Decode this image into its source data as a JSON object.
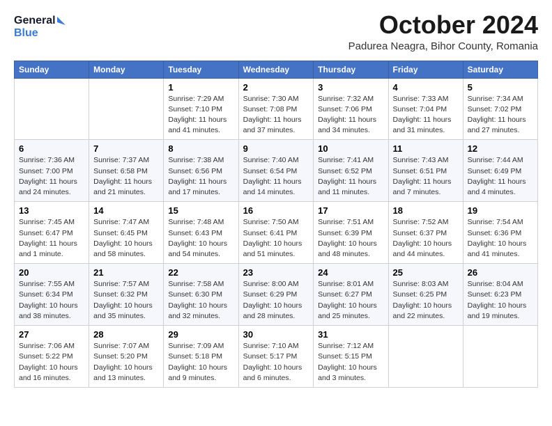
{
  "header": {
    "logo_line1": "General",
    "logo_line2": "Blue",
    "month": "October 2024",
    "location": "Padurea Neagra, Bihor County, Romania"
  },
  "weekdays": [
    "Sunday",
    "Monday",
    "Tuesday",
    "Wednesday",
    "Thursday",
    "Friday",
    "Saturday"
  ],
  "weeks": [
    [
      {
        "day": "",
        "info": ""
      },
      {
        "day": "",
        "info": ""
      },
      {
        "day": "1",
        "info": "Sunrise: 7:29 AM\nSunset: 7:10 PM\nDaylight: 11 hours and 41 minutes."
      },
      {
        "day": "2",
        "info": "Sunrise: 7:30 AM\nSunset: 7:08 PM\nDaylight: 11 hours and 37 minutes."
      },
      {
        "day": "3",
        "info": "Sunrise: 7:32 AM\nSunset: 7:06 PM\nDaylight: 11 hours and 34 minutes."
      },
      {
        "day": "4",
        "info": "Sunrise: 7:33 AM\nSunset: 7:04 PM\nDaylight: 11 hours and 31 minutes."
      },
      {
        "day": "5",
        "info": "Sunrise: 7:34 AM\nSunset: 7:02 PM\nDaylight: 11 hours and 27 minutes."
      }
    ],
    [
      {
        "day": "6",
        "info": "Sunrise: 7:36 AM\nSunset: 7:00 PM\nDaylight: 11 hours and 24 minutes."
      },
      {
        "day": "7",
        "info": "Sunrise: 7:37 AM\nSunset: 6:58 PM\nDaylight: 11 hours and 21 minutes."
      },
      {
        "day": "8",
        "info": "Sunrise: 7:38 AM\nSunset: 6:56 PM\nDaylight: 11 hours and 17 minutes."
      },
      {
        "day": "9",
        "info": "Sunrise: 7:40 AM\nSunset: 6:54 PM\nDaylight: 11 hours and 14 minutes."
      },
      {
        "day": "10",
        "info": "Sunrise: 7:41 AM\nSunset: 6:52 PM\nDaylight: 11 hours and 11 minutes."
      },
      {
        "day": "11",
        "info": "Sunrise: 7:43 AM\nSunset: 6:51 PM\nDaylight: 11 hours and 7 minutes."
      },
      {
        "day": "12",
        "info": "Sunrise: 7:44 AM\nSunset: 6:49 PM\nDaylight: 11 hours and 4 minutes."
      }
    ],
    [
      {
        "day": "13",
        "info": "Sunrise: 7:45 AM\nSunset: 6:47 PM\nDaylight: 11 hours and 1 minute."
      },
      {
        "day": "14",
        "info": "Sunrise: 7:47 AM\nSunset: 6:45 PM\nDaylight: 10 hours and 58 minutes."
      },
      {
        "day": "15",
        "info": "Sunrise: 7:48 AM\nSunset: 6:43 PM\nDaylight: 10 hours and 54 minutes."
      },
      {
        "day": "16",
        "info": "Sunrise: 7:50 AM\nSunset: 6:41 PM\nDaylight: 10 hours and 51 minutes."
      },
      {
        "day": "17",
        "info": "Sunrise: 7:51 AM\nSunset: 6:39 PM\nDaylight: 10 hours and 48 minutes."
      },
      {
        "day": "18",
        "info": "Sunrise: 7:52 AM\nSunset: 6:37 PM\nDaylight: 10 hours and 44 minutes."
      },
      {
        "day": "19",
        "info": "Sunrise: 7:54 AM\nSunset: 6:36 PM\nDaylight: 10 hours and 41 minutes."
      }
    ],
    [
      {
        "day": "20",
        "info": "Sunrise: 7:55 AM\nSunset: 6:34 PM\nDaylight: 10 hours and 38 minutes."
      },
      {
        "day": "21",
        "info": "Sunrise: 7:57 AM\nSunset: 6:32 PM\nDaylight: 10 hours and 35 minutes."
      },
      {
        "day": "22",
        "info": "Sunrise: 7:58 AM\nSunset: 6:30 PM\nDaylight: 10 hours and 32 minutes."
      },
      {
        "day": "23",
        "info": "Sunrise: 8:00 AM\nSunset: 6:29 PM\nDaylight: 10 hours and 28 minutes."
      },
      {
        "day": "24",
        "info": "Sunrise: 8:01 AM\nSunset: 6:27 PM\nDaylight: 10 hours and 25 minutes."
      },
      {
        "day": "25",
        "info": "Sunrise: 8:03 AM\nSunset: 6:25 PM\nDaylight: 10 hours and 22 minutes."
      },
      {
        "day": "26",
        "info": "Sunrise: 8:04 AM\nSunset: 6:23 PM\nDaylight: 10 hours and 19 minutes."
      }
    ],
    [
      {
        "day": "27",
        "info": "Sunrise: 7:06 AM\nSunset: 5:22 PM\nDaylight: 10 hours and 16 minutes."
      },
      {
        "day": "28",
        "info": "Sunrise: 7:07 AM\nSunset: 5:20 PM\nDaylight: 10 hours and 13 minutes."
      },
      {
        "day": "29",
        "info": "Sunrise: 7:09 AM\nSunset: 5:18 PM\nDaylight: 10 hours and 9 minutes."
      },
      {
        "day": "30",
        "info": "Sunrise: 7:10 AM\nSunset: 5:17 PM\nDaylight: 10 hours and 6 minutes."
      },
      {
        "day": "31",
        "info": "Sunrise: 7:12 AM\nSunset: 5:15 PM\nDaylight: 10 hours and 3 minutes."
      },
      {
        "day": "",
        "info": ""
      },
      {
        "day": "",
        "info": ""
      }
    ]
  ]
}
